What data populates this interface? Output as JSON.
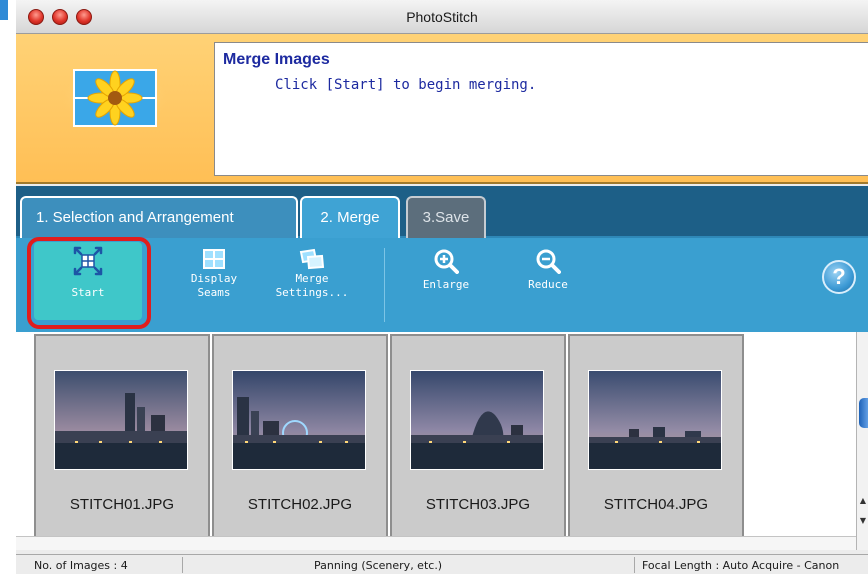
{
  "window": {
    "title": "PhotoStitch"
  },
  "header": {
    "title": "Merge Images",
    "instruction": "Click [Start] to begin merging."
  },
  "tabs": [
    {
      "label": "1. Selection and Arrangement",
      "state": "inactive"
    },
    {
      "label": "2. Merge",
      "state": "active"
    },
    {
      "label": "3.Save",
      "state": "disabled"
    }
  ],
  "toolbar": {
    "start_label": "Start",
    "seams_label_1": "Display",
    "seams_label_2": "Seams",
    "merge_label_1": "Merge",
    "merge_label_2": "Settings...",
    "enlarge_label": "Enlarge",
    "reduce_label": "Reduce",
    "help_label": "?"
  },
  "images": [
    {
      "filename": "STITCH01.JPG"
    },
    {
      "filename": "STITCH02.JPG"
    },
    {
      "filename": "STITCH03.JPG"
    },
    {
      "filename": "STITCH04.JPG"
    }
  ],
  "status": {
    "image_count": "No. of Images : 4",
    "mode": "Panning (Scenery, etc.)",
    "focal": "Focal Length : Auto Acquire - Canon"
  },
  "colors": {
    "header_band": "#ffc964",
    "toolbar": "#3a9fd0",
    "tab_bar": "#1d5f87",
    "highlight": "#e01d1d",
    "title_text": "#1d2aa0"
  }
}
